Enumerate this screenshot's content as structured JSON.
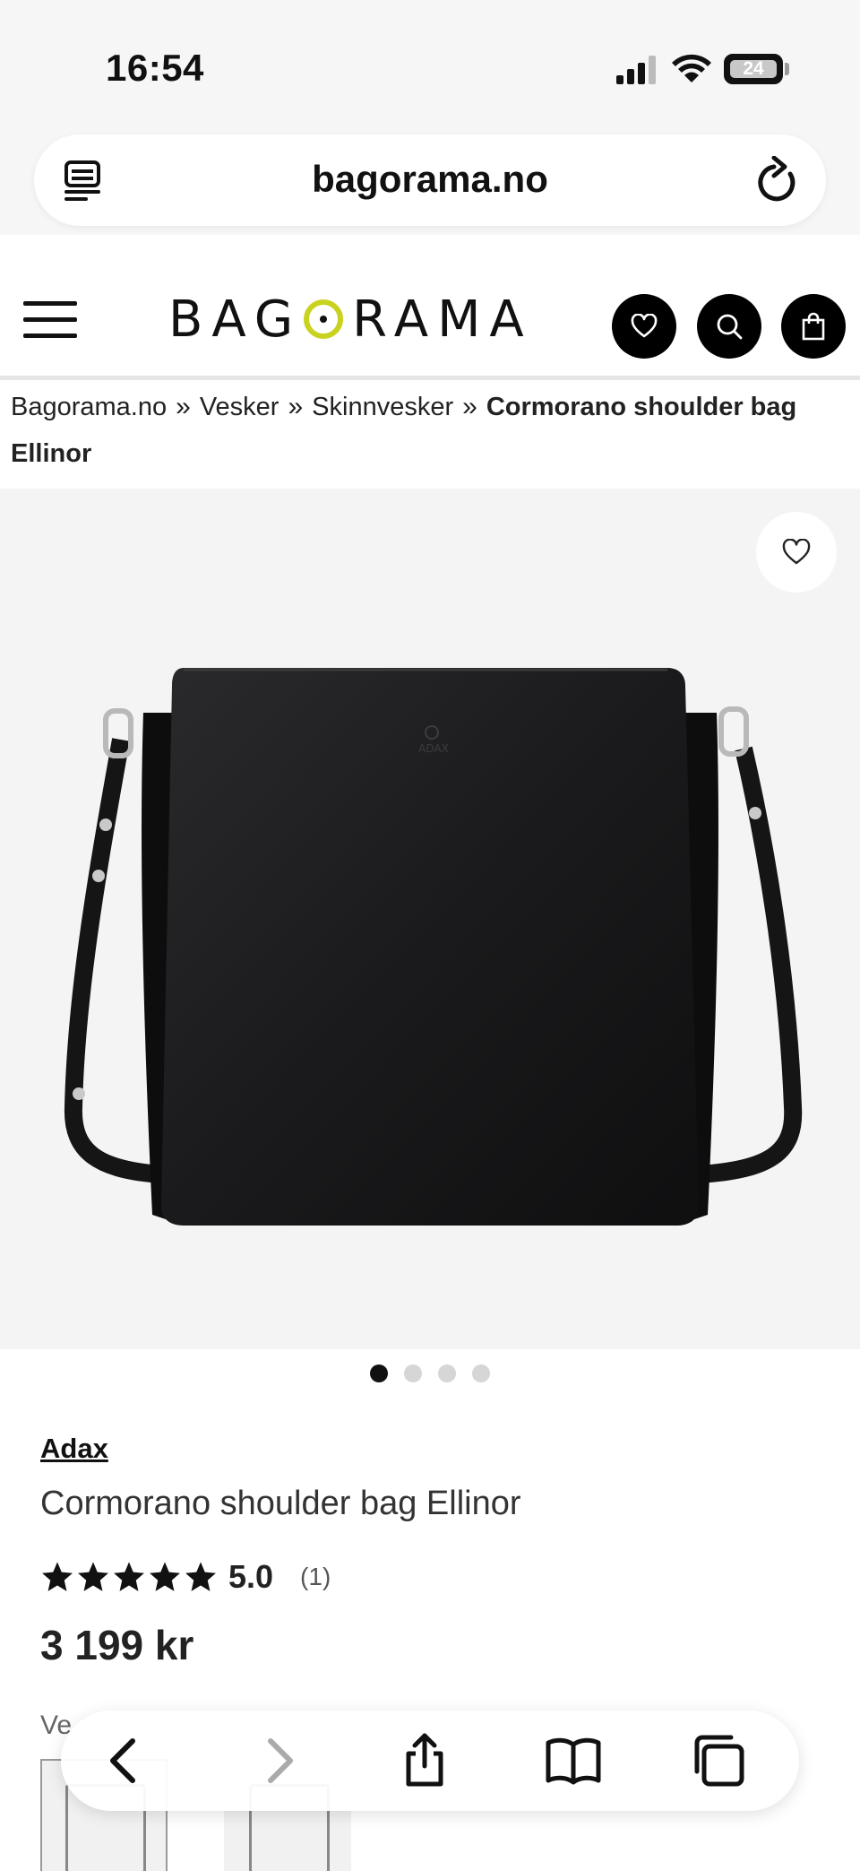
{
  "status_bar": {
    "time": "16:54",
    "battery": "24"
  },
  "browser": {
    "url": "bagorama.no"
  },
  "site": {
    "logo_prefix": "BAG",
    "logo_suffix": "RAMA",
    "accent_color": "#c9d21f"
  },
  "breadcrumb": {
    "items": [
      "Bagorama.no",
      "Vesker",
      "Skinnvesker"
    ],
    "separator": "»",
    "current": "Cormorano shoulder bag Ellinor"
  },
  "product": {
    "brand": "Adax",
    "title": "Cormorano shoulder bag Ellinor",
    "rating_value": "5.0",
    "rating_count": "(1)",
    "stars": 5,
    "price": "3 199 kr",
    "variant_label": "Ve",
    "gallery_dots": 4,
    "active_dot": 0,
    "bag_logo": "ADAX"
  },
  "toolbar": {
    "icons": [
      "back-icon",
      "forward-icon",
      "share-icon",
      "bookmarks-icon",
      "tabs-icon"
    ]
  }
}
